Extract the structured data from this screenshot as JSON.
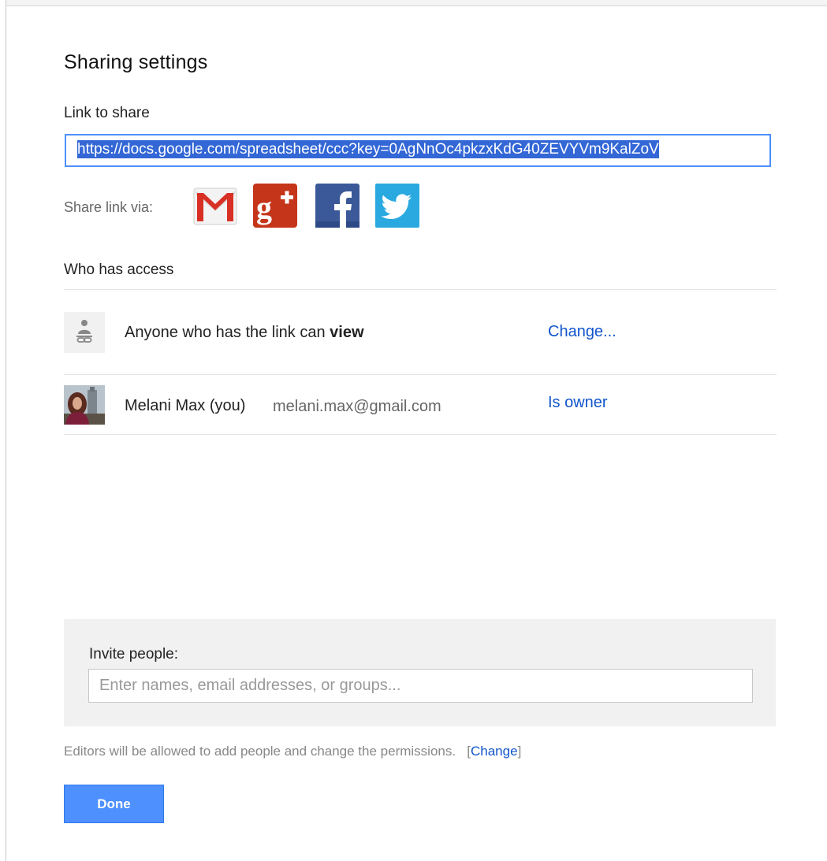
{
  "dialog": {
    "title": "Sharing settings",
    "link_label": "Link to share",
    "link_value": "https://docs.google.com/spreadsheet/ccc?key=0AgNnOc4pkzxKdG40ZEVYVm9KalZoV",
    "share_via_label": "Share link via:",
    "share_services": [
      {
        "name": "Gmail",
        "icon": "gmail-icon",
        "color": "#d93025"
      },
      {
        "name": "Google+",
        "icon": "google-plus-icon",
        "color": "#c5351a"
      },
      {
        "name": "Facebook",
        "icon": "facebook-icon",
        "color": "#3b5998"
      },
      {
        "name": "Twitter",
        "icon": "twitter-icon",
        "color": "#2aa9e0"
      }
    ],
    "access_heading": "Who has access",
    "access": {
      "link_row": {
        "prefix": "Anyone who has the link can",
        "permission": "view",
        "action": "Change..."
      },
      "owner_row": {
        "name": "Melani Max (you)",
        "email": "melani.max@gmail.com",
        "role": "Is owner"
      }
    },
    "invite": {
      "label": "Invite people:",
      "placeholder": "Enter names, email addresses, or groups..."
    },
    "editors_note": {
      "text": "Editors will be allowed to add people and change the permissions.",
      "link": "Change"
    },
    "done_label": "Done"
  },
  "colors": {
    "accent": "#4d90fe",
    "link": "#1155cc",
    "selection": "#3367d6"
  }
}
